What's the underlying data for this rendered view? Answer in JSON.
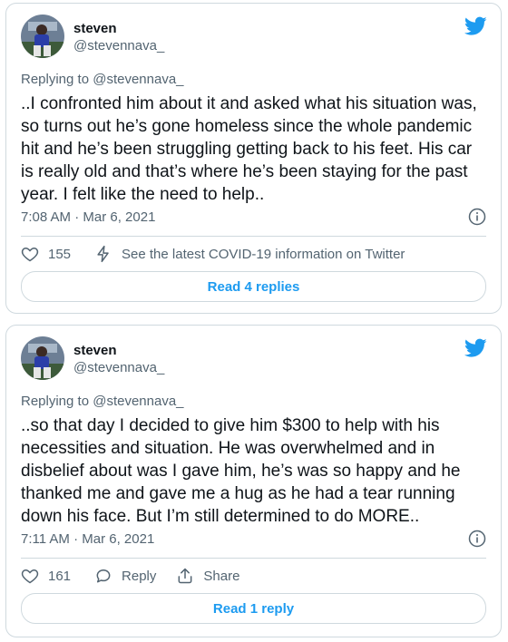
{
  "colors": {
    "accent": "#1d9bf0",
    "text": "#0f1419",
    "muted": "#536471",
    "border": "#cfd9de"
  },
  "tweets": [
    {
      "author": {
        "name": "steven",
        "handle": "@stevennava_"
      },
      "replying_to": "Replying to @stevennava_",
      "text": "..I confronted him about it and asked what his situation was, so turns out he’s gone homeless since the whole pandemic hit and he’s been struggling getting back to his feet. His car is really old and that’s where he’s been staying for the past year. I felt like the need to help..",
      "timestamp": "7:08 AM · Mar 6, 2021",
      "likes": "155",
      "secondary_action": "See the latest COVID-19 information on Twitter",
      "read_replies": "Read 4 replies"
    },
    {
      "author": {
        "name": "steven",
        "handle": "@stevennava_"
      },
      "replying_to": "Replying to @stevennava_",
      "text": "..so that day I decided to give him $300 to help with his necessities and situation. He was overwhelmed and in disbelief about was I gave him, he’s was so happy and he thanked me and gave me a hug as he had a tear running down his face. But I’m still determined to do MORE..",
      "timestamp": "7:11 AM · Mar 6, 2021",
      "likes": "161",
      "reply_label": "Reply",
      "share_label": "Share",
      "read_replies": "Read 1 reply"
    }
  ]
}
